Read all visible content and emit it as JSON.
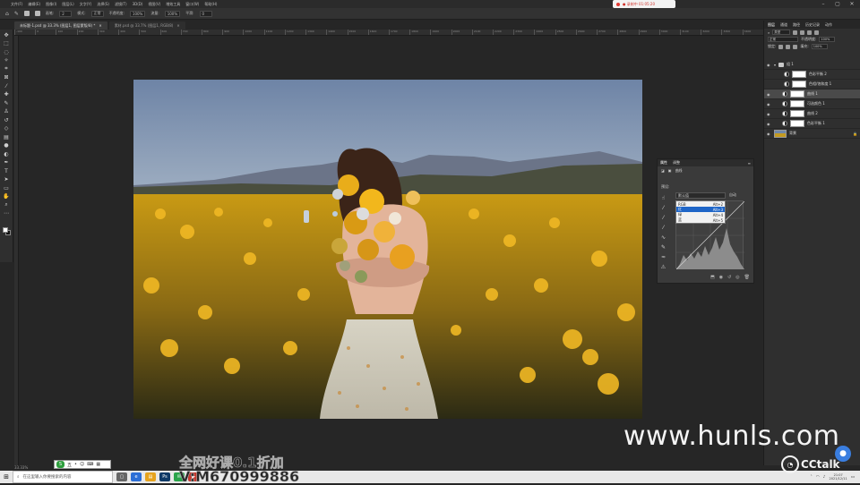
{
  "menubar": {
    "items": [
      "文件(F)",
      "编辑(E)",
      "图像(I)",
      "图层(L)",
      "文字(Y)",
      "选择(S)",
      "滤镜(T)",
      "3D(D)",
      "视图(V)",
      "增效工具",
      "窗口(W)",
      "帮助(H)"
    ],
    "recording": "● 录制中 01:05:20"
  },
  "options": {
    "size_label": "画笔:",
    "size_value": "2",
    "mode_label": "模式:",
    "mode_value": "正常",
    "opacity_label": "不透明度:",
    "opacity_value": "100%",
    "flow_label": "流量:",
    "flow_value": "100%",
    "smooth_label": "平滑:",
    "smooth_value": "0"
  },
  "tabs": [
    {
      "label": "未标题-1.psd @ 33.3% (图层1, 图层蒙版/8) *",
      "active": true
    },
    {
      "label": "素材.psd @ 33.7% (图层1, RGB/8)",
      "active": false
    }
  ],
  "ruler": [
    "-100",
    "0",
    "100",
    "200",
    "300",
    "400",
    "500",
    "600",
    "700",
    "800",
    "900",
    "1000",
    "1100",
    "1200",
    "1300",
    "1400",
    "1500",
    "1600",
    "1700",
    "1800",
    "1900",
    "2000",
    "2100",
    "2200",
    "2300",
    "2400",
    "2500",
    "2600",
    "2700",
    "2800",
    "2900",
    "3000",
    "3100",
    "3200",
    "3300",
    "3400"
  ],
  "props": {
    "tab_properties": "属性",
    "tab_adjust": "调整",
    "type_label": "曲线",
    "preset_label": "预设:",
    "preset_value": "默认值",
    "auto_label": "自动",
    "channels": [
      {
        "name": "RGB",
        "shortcut": "Alt+2",
        "selected": false
      },
      {
        "name": "红",
        "shortcut": "Alt+3",
        "selected": true
      },
      {
        "name": "绿",
        "shortcut": "Alt+4",
        "selected": false
      },
      {
        "name": "蓝",
        "shortcut": "Alt+5",
        "selected": false
      }
    ]
  },
  "rpanel": {
    "tabs": [
      "图层",
      "通道",
      "路径",
      "历史记录",
      "动作"
    ],
    "kind_label": "类型",
    "mode_value": "正常",
    "opacity_label": "不透明度:",
    "opacity_value": "100%",
    "lock_label": "锁定:",
    "fill_label": "填充:",
    "fill_value": "100%",
    "layers": [
      {
        "name": "组 1",
        "type": "group",
        "visible": true,
        "selected": false
      },
      {
        "name": "色彩平衡 2",
        "type": "adj",
        "visible": false,
        "selected": false
      },
      {
        "name": "色相/饱和度 1",
        "type": "adj",
        "visible": false,
        "selected": false
      },
      {
        "name": "曲线 1",
        "type": "adj",
        "visible": true,
        "selected": true
      },
      {
        "name": "可选颜色 1",
        "type": "adj",
        "visible": true,
        "selected": false
      },
      {
        "name": "曲线 2",
        "type": "adj",
        "visible": true,
        "selected": false
      },
      {
        "name": "色彩平衡 1",
        "type": "adj",
        "visible": true,
        "selected": false
      },
      {
        "name": "背景",
        "type": "image",
        "visible": true,
        "selected": false
      }
    ]
  },
  "status": {
    "zoom": "33.33%"
  },
  "overlay": {
    "watermark": "www.hunls.com",
    "promo1": "全网好课0.1折加",
    "promo2": "V:M670999886",
    "cctalk": "CCtalk"
  },
  "ime": {
    "label": "五"
  },
  "taskbar": {
    "search_placeholder": "在这里输入你要搜索的内容",
    "time": "21:07",
    "date": "2021/12/11"
  }
}
